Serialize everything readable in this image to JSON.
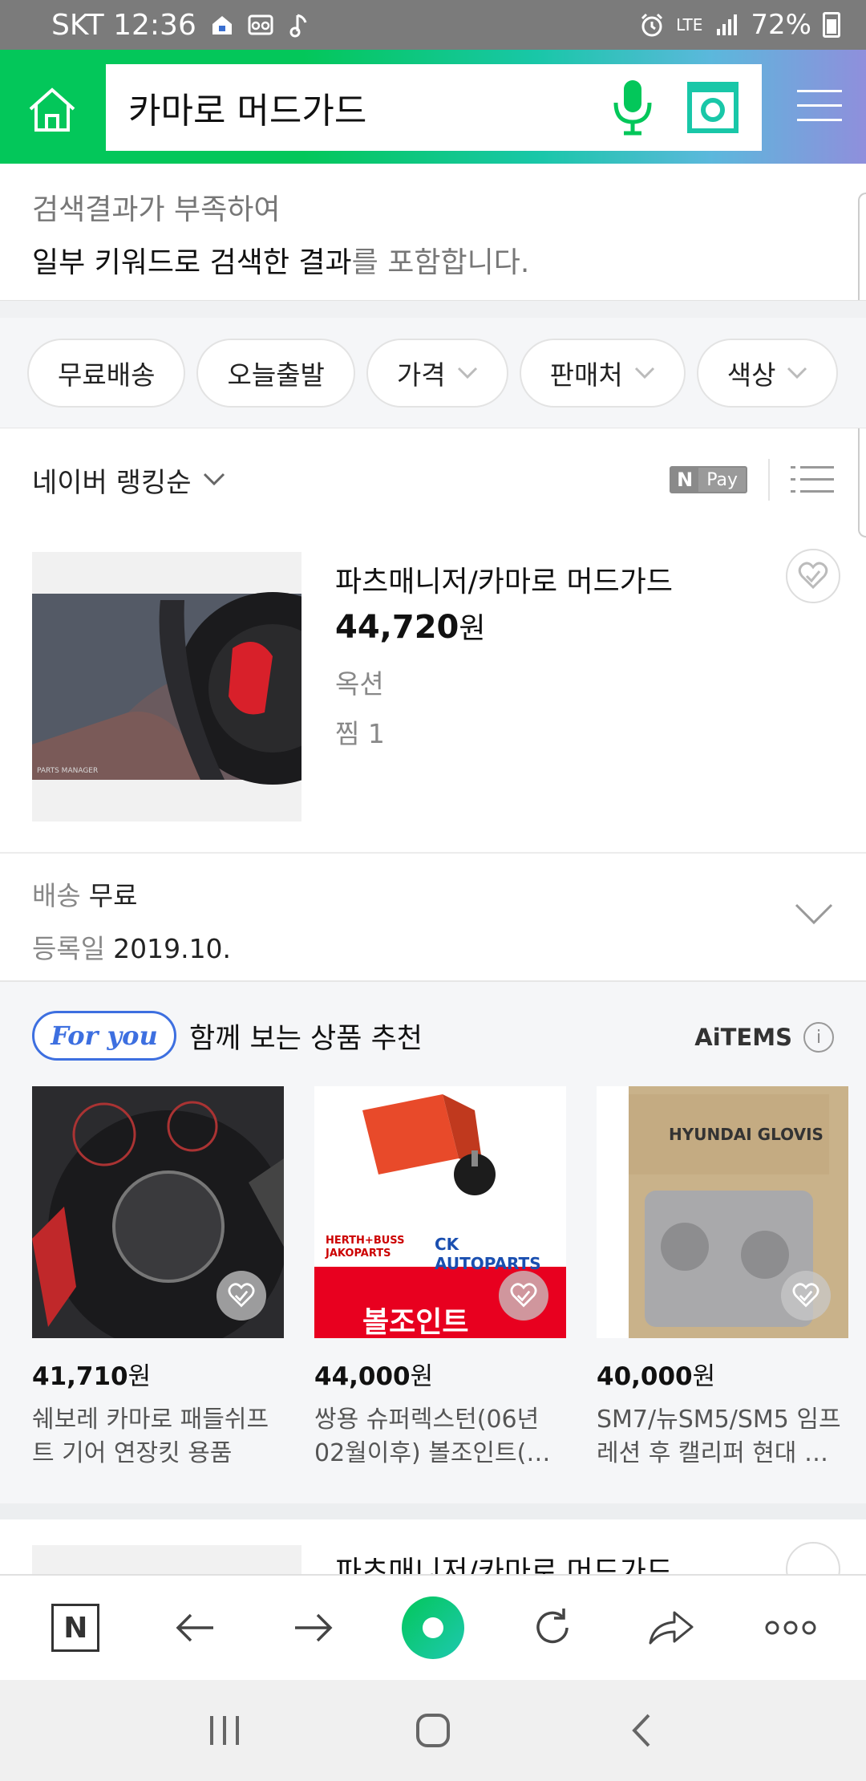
{
  "status_bar": {
    "carrier_time": "SKT 12:36",
    "network": "LTE",
    "battery": "72%"
  },
  "search": {
    "query": "카마로 머드가드"
  },
  "notice": {
    "line1": "검색결과가 부족하여",
    "line2_main": "일부 키워드로 검색한 결과",
    "line2_rest": "를 포함합니다."
  },
  "filters": [
    {
      "label": "무료배송",
      "has_dropdown": false
    },
    {
      "label": "오늘출발",
      "has_dropdown": false
    },
    {
      "label": "가격",
      "has_dropdown": true
    },
    {
      "label": "판매처",
      "has_dropdown": true
    },
    {
      "label": "색상",
      "has_dropdown": true
    }
  ],
  "sort": {
    "label": "네이버 랭킹순",
    "npay_n": "N",
    "npay_pay": "Pay"
  },
  "product": {
    "title": "파츠매니저/카마로 머드가드",
    "price": "44,720",
    "currency": "원",
    "option": "옥션",
    "wish": "찜 1",
    "image_caption": "PARTS MANAGER"
  },
  "shipping": {
    "label": "배송",
    "value": "무료",
    "date_label": "등록일",
    "date_value": "2019.10."
  },
  "recommend": {
    "badge": "For you",
    "title": "함께 보는 상품 추천",
    "brand": "AiTEMS",
    "info_icon": "i",
    "items": [
      {
        "price": "41,710",
        "currency": "원",
        "name": "쉐보레 카마로 패들쉬프트 기어 연장킷 용품"
      },
      {
        "price": "44,000",
        "currency": "원",
        "name": "쌍용 슈퍼렉스턴(06년02월이후) 볼조인트(…",
        "img_brand1": "HERTH+BUSS JAKOPARTS",
        "img_brand2": "CK AUTOPARTS",
        "img_text": "볼조인트"
      },
      {
        "price": "40,000",
        "currency": "원",
        "name": "SM7/뉴SM5/SM5 임프레션 후 캘리퍼 현대 …",
        "img_brand": "HYUNDAI GLOVIS"
      }
    ]
  },
  "next_product": {
    "title": "파츠매니저/카마로 머드가드"
  },
  "browser_bar": {
    "n_label": "N"
  },
  "colors": {
    "naver_green": "#03c75a",
    "for_you_blue": "#3d6fe0"
  }
}
